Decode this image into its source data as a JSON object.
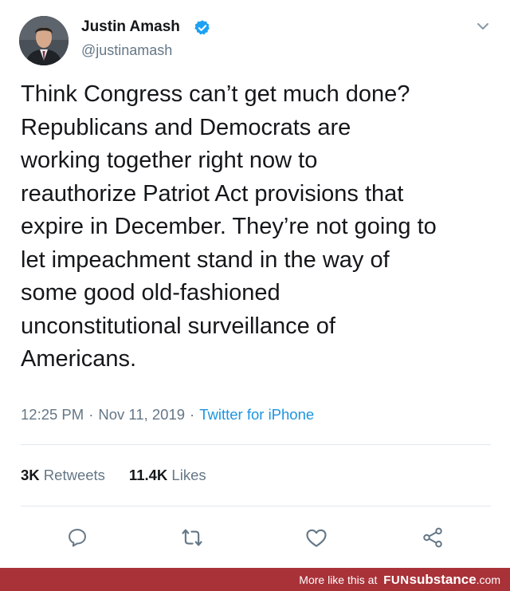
{
  "tweet": {
    "author_name": "Justin Amash",
    "author_handle": "@justinamash",
    "text": "Think Congress can’t get much done?\nRepublicans and Democrats are\nworking together right now to\nreauthorize Patriot Act provisions that\nexpire in December. They’re not going to\nlet impeachment stand in the way of\nsome good old-fashioned\nunconstitutional surveillance of\nAmericans.",
    "time": "12:25 PM",
    "date": "Nov 11, 2019",
    "separator": "·",
    "source": "Twitter for iPhone"
  },
  "stats": {
    "retweets_count": "3K",
    "retweets_label": "Retweets",
    "likes_count": "11.4K",
    "likes_label": "Likes"
  },
  "icons": {
    "verified": "verified-badge-icon",
    "caret": "chevron-down-icon",
    "reply": "reply-icon",
    "retweet": "retweet-icon",
    "like": "heart-icon",
    "share": "share-icon"
  },
  "colors": {
    "text": "#14171a",
    "secondary": "#657786",
    "link": "#1b95e0",
    "verified": "#1da1f2",
    "footer_bg": "#a83238"
  },
  "footer": {
    "prefix": "More like this at",
    "brand_fun": "FUN",
    "brand_substance": "substance",
    "brand_suffix": ".com"
  }
}
